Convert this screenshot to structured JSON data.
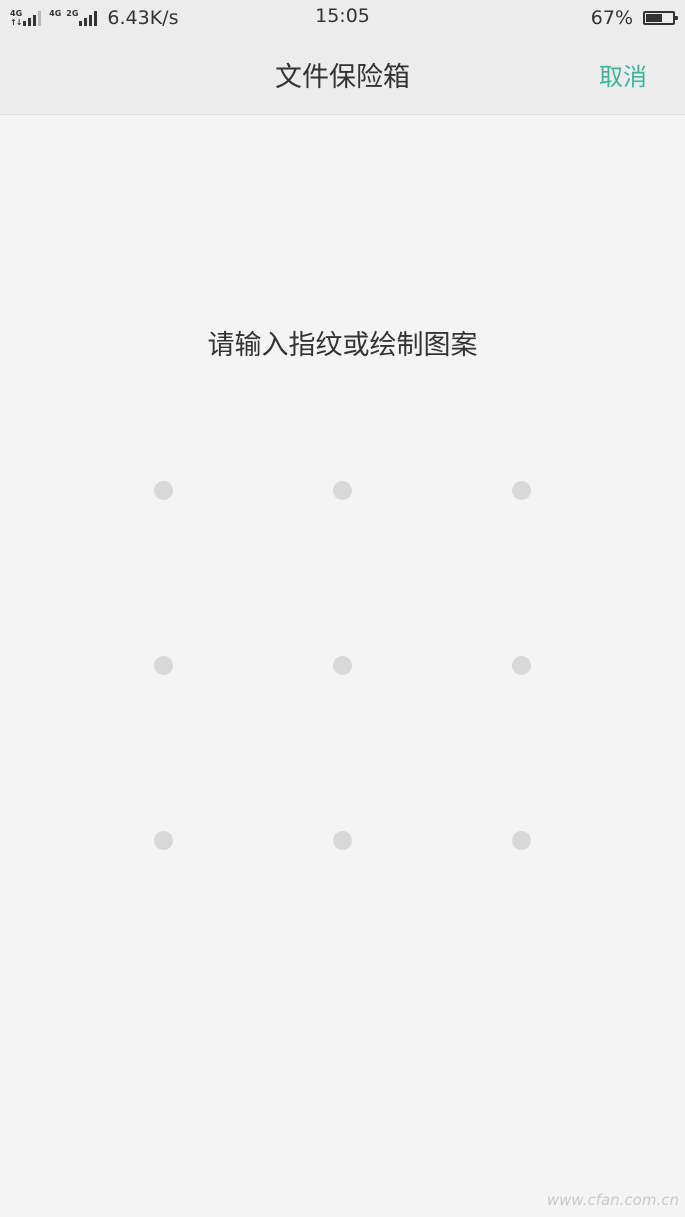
{
  "status_bar": {
    "sim1_label": "4G",
    "sim1b_label": "4G",
    "sim2_label": "2G",
    "arrows": "↑↓",
    "speed": "6.43K/s",
    "time": "15:05",
    "battery_percent": "67%",
    "battery_level": 0.67
  },
  "header": {
    "title": "文件保险箱",
    "cancel_label": "取消",
    "accent_color": "#3fb39a"
  },
  "main": {
    "prompt": "请输入指纹或绘制图案"
  },
  "pattern": {
    "rows": 3,
    "cols": 3
  },
  "watermark": "www.cfan.com.cn"
}
